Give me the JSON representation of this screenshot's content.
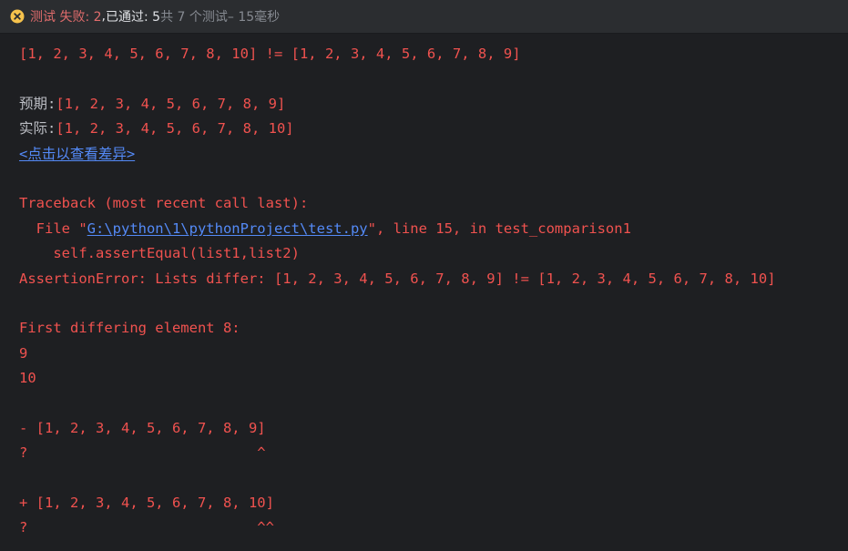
{
  "header": {
    "status_fail": "测试 失败: 2",
    "separator": ", ",
    "passed": "已通过: 5",
    "total": "共 7 个测试",
    "duration": " – 15毫秒",
    "colors": {
      "fail": "#e06c6c",
      "text": "#dfe1e5",
      "muted": "#868a91"
    },
    "icon": "error-circle-icon"
  },
  "console": {
    "line1": "[1, 2, 3, 4, 5, 6, 7, 8, 10] != [1, 2, 3, 4, 5, 6, 7, 8, 9]",
    "expected_label": "预期:",
    "expected_value": "[1, 2, 3, 4, 5, 6, 7, 8, 9]",
    "actual_label": "实际:",
    "actual_value": "[1, 2, 3, 4, 5, 6, 7, 8, 10]",
    "diff_link": "<点击以查看差异>",
    "traceback": "Traceback (most recent call last):",
    "file_prefix": "  File \"",
    "file_path": "G:\\python\\1\\pythonProject\\test.py",
    "file_suffix": "\", line 15, in test_comparison1",
    "code_line": "    self.assertEqual(list1,list2)",
    "assertion": "AssertionError: Lists differ: [1, 2, 3, 4, 5, 6, 7, 8, 9] != [1, 2, 3, 4, 5, 6, 7, 8, 10]",
    "first_diff": "First differing element 8:",
    "val_a": "9",
    "val_b": "10",
    "minus_line": "- [1, 2, 3, 4, 5, 6, 7, 8, 9]",
    "marker1": "?                           ^",
    "plus_line": "+ [1, 2, 3, 4, 5, 6, 7, 8, 10]",
    "marker2": "?                           ^^",
    "colors": {
      "error": "#f0524f",
      "normal": "#bcbec4",
      "link": "#548af7",
      "background": "#1e1f22"
    }
  }
}
